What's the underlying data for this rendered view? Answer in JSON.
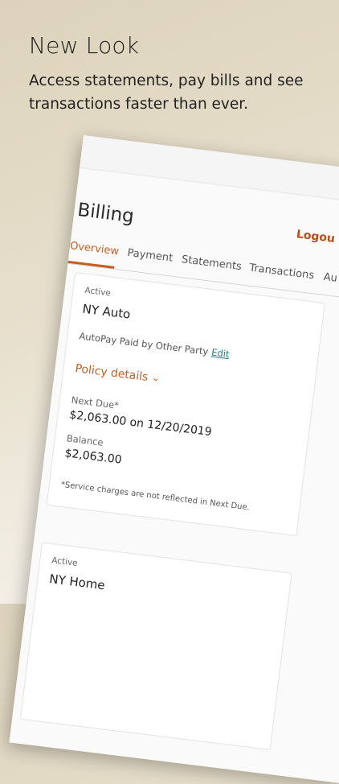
{
  "promo": {
    "headline": "New Look",
    "subline": "Access statements, pay bills and see transactions faster than ever."
  },
  "app": {
    "title": "Billing",
    "logout_label": "Logou",
    "tabs": [
      {
        "label": "Overview",
        "active": true
      },
      {
        "label": "Payment",
        "active": false
      },
      {
        "label": "Statements",
        "active": false
      },
      {
        "label": "Transactions",
        "active": false
      },
      {
        "label": "Au",
        "active": false
      }
    ]
  },
  "policies": [
    {
      "status": "Active",
      "name": "NY Auto",
      "autopay_text": "AutoPay Paid by Other Party",
      "edit_label": "Edit",
      "details_label": "Policy details",
      "next_due_label": "Next Due*",
      "next_due_value": "$2,063.00 on 12/20/2019",
      "balance_label": "Balance",
      "balance_value": "$2,063.00",
      "footnote": "*Service charges are not reflected in Next Due."
    },
    {
      "status": "Active",
      "name": "NY Home"
    }
  ],
  "colors": {
    "accent": "#c45e1f",
    "link": "#1a7d8c",
    "background": "#e5dcc8"
  }
}
